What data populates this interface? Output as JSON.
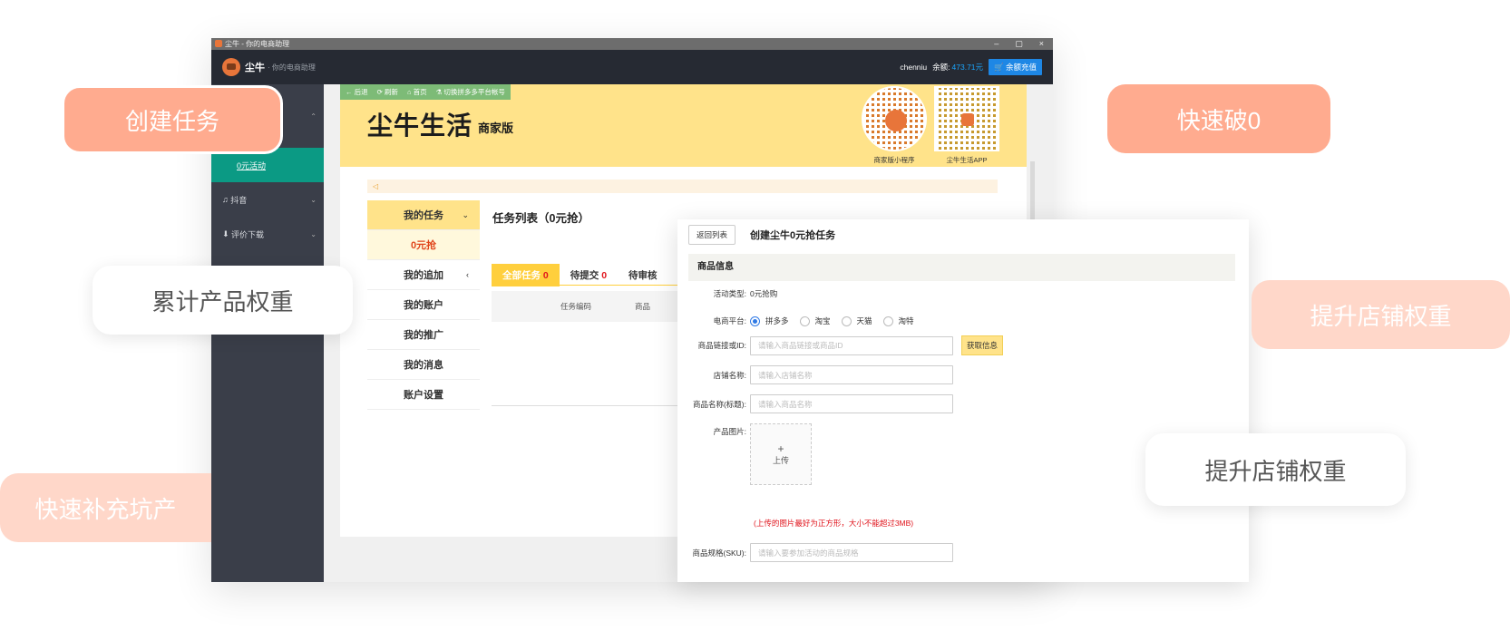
{
  "window": {
    "title": "尘牛 - 你的电商助理",
    "minimize": "–",
    "maximize": "▢",
    "close": "×"
  },
  "header": {
    "brand": "尘牛",
    "brand_sub": "· 你的电商助理",
    "username": "chenniu",
    "balance_label": "余额:",
    "balance_value": "473.71元",
    "recharge_label": "余额充值"
  },
  "sidebar": {
    "items": [
      {
        "label": "0元活动"
      },
      {
        "label": "抖音"
      },
      {
        "label": "评价下载"
      }
    ]
  },
  "toolbar": {
    "items": [
      "后退",
      "刷新",
      "首页",
      "切换拼多多平台帐号"
    ]
  },
  "banner": {
    "title": "尘牛生活",
    "subtitle": "商家版",
    "qr_mini_label": "商家版小程序",
    "qr_app_label": "尘牛生活APP"
  },
  "left_menu": {
    "items": [
      {
        "label": "我的任务"
      },
      {
        "label": "0元抢"
      },
      {
        "label": "我的追加"
      },
      {
        "label": "我的账户"
      },
      {
        "label": "我的推广"
      },
      {
        "label": "我的消息"
      },
      {
        "label": "账户设置"
      }
    ]
  },
  "task_list": {
    "title": "任务列表（0元抢）",
    "tabs": [
      {
        "label": "全部任务",
        "count": "0"
      },
      {
        "label": "待提交",
        "count": "0"
      },
      {
        "label": "待审核",
        "count": ""
      }
    ],
    "columns": [
      "任务编码",
      "商品"
    ]
  },
  "form": {
    "back_label": "返回列表",
    "title": "创建尘牛0元抢任务",
    "section": "商品信息",
    "activity_type_label": "活动类型:",
    "activity_type_value": "0元抢购",
    "platform_label": "电商平台:",
    "platforms": [
      "拼多多",
      "淘宝",
      "天猫",
      "淘特"
    ],
    "selected_platform": "拼多多",
    "link_label": "商品链接或ID:",
    "link_placeholder": "请输入商品链接或商品ID",
    "fetch_label": "获取信息",
    "shop_label": "店铺名称:",
    "shop_placeholder": "请输入店铺名称",
    "product_label": "商品名称(标题):",
    "product_placeholder": "请输入商品名称",
    "image_label": "产品图片:",
    "upload_plus": "+",
    "upload_label": "上传",
    "upload_hint": "(上传的图片最好为正方形，大小不能超过3MB)",
    "sku_label": "商品规格(SKU):",
    "sku_placeholder": "请输入要参加活动的商品规格"
  },
  "pills": {
    "create_task": "创建任务",
    "fast_break": "快速破0",
    "accumulate_weight": "累计产品权重",
    "boost_store_1": "提升店铺权重",
    "boost_store_2": "提升店铺权重",
    "fill_pit": "快速补充坑产"
  },
  "colors": {
    "accent_orange": "#ffab8f",
    "banner_yellow": "#ffe38a",
    "sidebar_dark": "#3a3e49",
    "active_teal": "#0b9a84"
  }
}
